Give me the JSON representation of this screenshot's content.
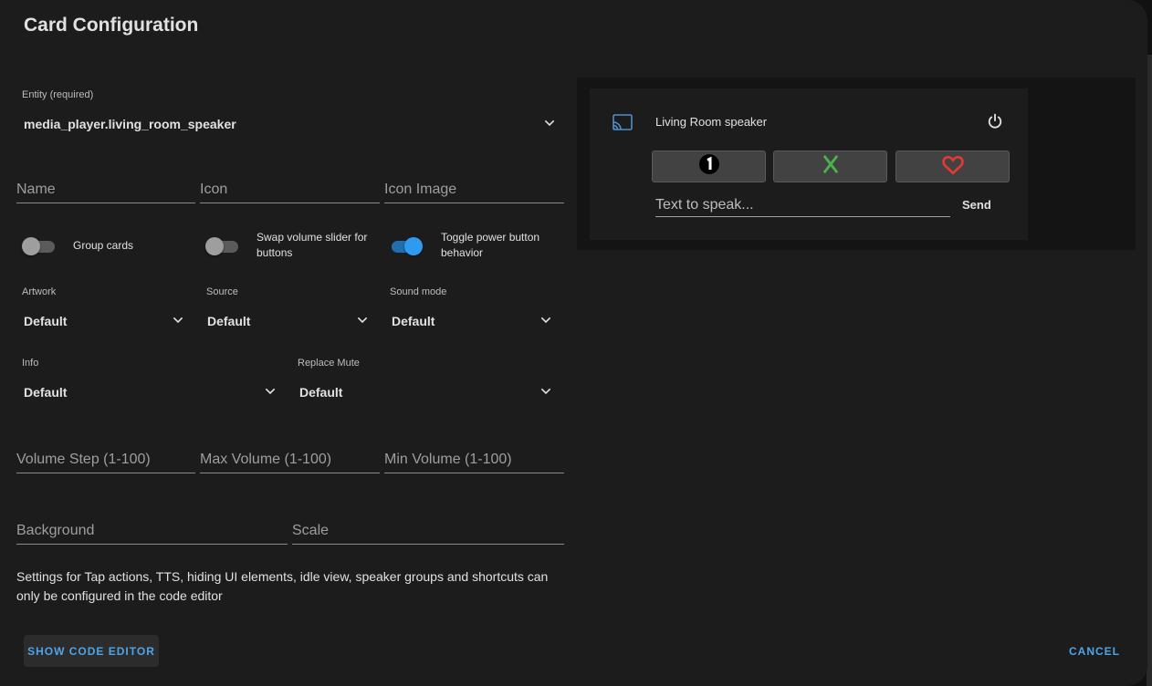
{
  "dialog": {
    "title": "Card Configuration"
  },
  "entity": {
    "label": "Entity (required)",
    "value": "media_player.living_room_speaker"
  },
  "text_fields_row1": [
    {
      "label": "Name"
    },
    {
      "label": "Icon"
    },
    {
      "label": "Icon Image"
    }
  ],
  "switches": [
    {
      "label": "Group cards",
      "on": false
    },
    {
      "label": "Swap volume slider for buttons",
      "on": false
    },
    {
      "label": "Toggle power button behavior",
      "on": true
    }
  ],
  "selects_row1": [
    {
      "label": "Artwork",
      "value": "Default"
    },
    {
      "label": "Source",
      "value": "Default"
    },
    {
      "label": "Sound mode",
      "value": "Default"
    }
  ],
  "selects_row2": [
    {
      "label": "Info",
      "value": "Default"
    },
    {
      "label": "Replace Mute",
      "value": "Default"
    }
  ],
  "text_fields_row2": [
    {
      "label": "Volume Step (1-100)"
    },
    {
      "label": "Max Volume (1-100)"
    },
    {
      "label": "Min Volume (1-100)"
    }
  ],
  "text_fields_row3": [
    {
      "label": "Background"
    },
    {
      "label": "Scale"
    }
  ],
  "note": "Settings for Tap actions, TTS, hiding UI elements, idle view, speaker groups and shortcuts can only be configured in the code editor",
  "buttons": {
    "show_code_editor": "SHOW CODE EDITOR",
    "cancel": "CANCEL"
  },
  "preview": {
    "player_name": "Living Room speaker",
    "tts_placeholder": "Text to speak...",
    "send_label": "Send",
    "shortcut_icons": [
      "numeric-1-circle-icon",
      "xbox-icon",
      "heart-outline-icon"
    ]
  },
  "colors": {
    "accent": "#4ea4e8",
    "switch_on": "#2f9bf0",
    "background": "#1c1c1c",
    "heart": "#e53935",
    "xbox": "#4caf50"
  }
}
